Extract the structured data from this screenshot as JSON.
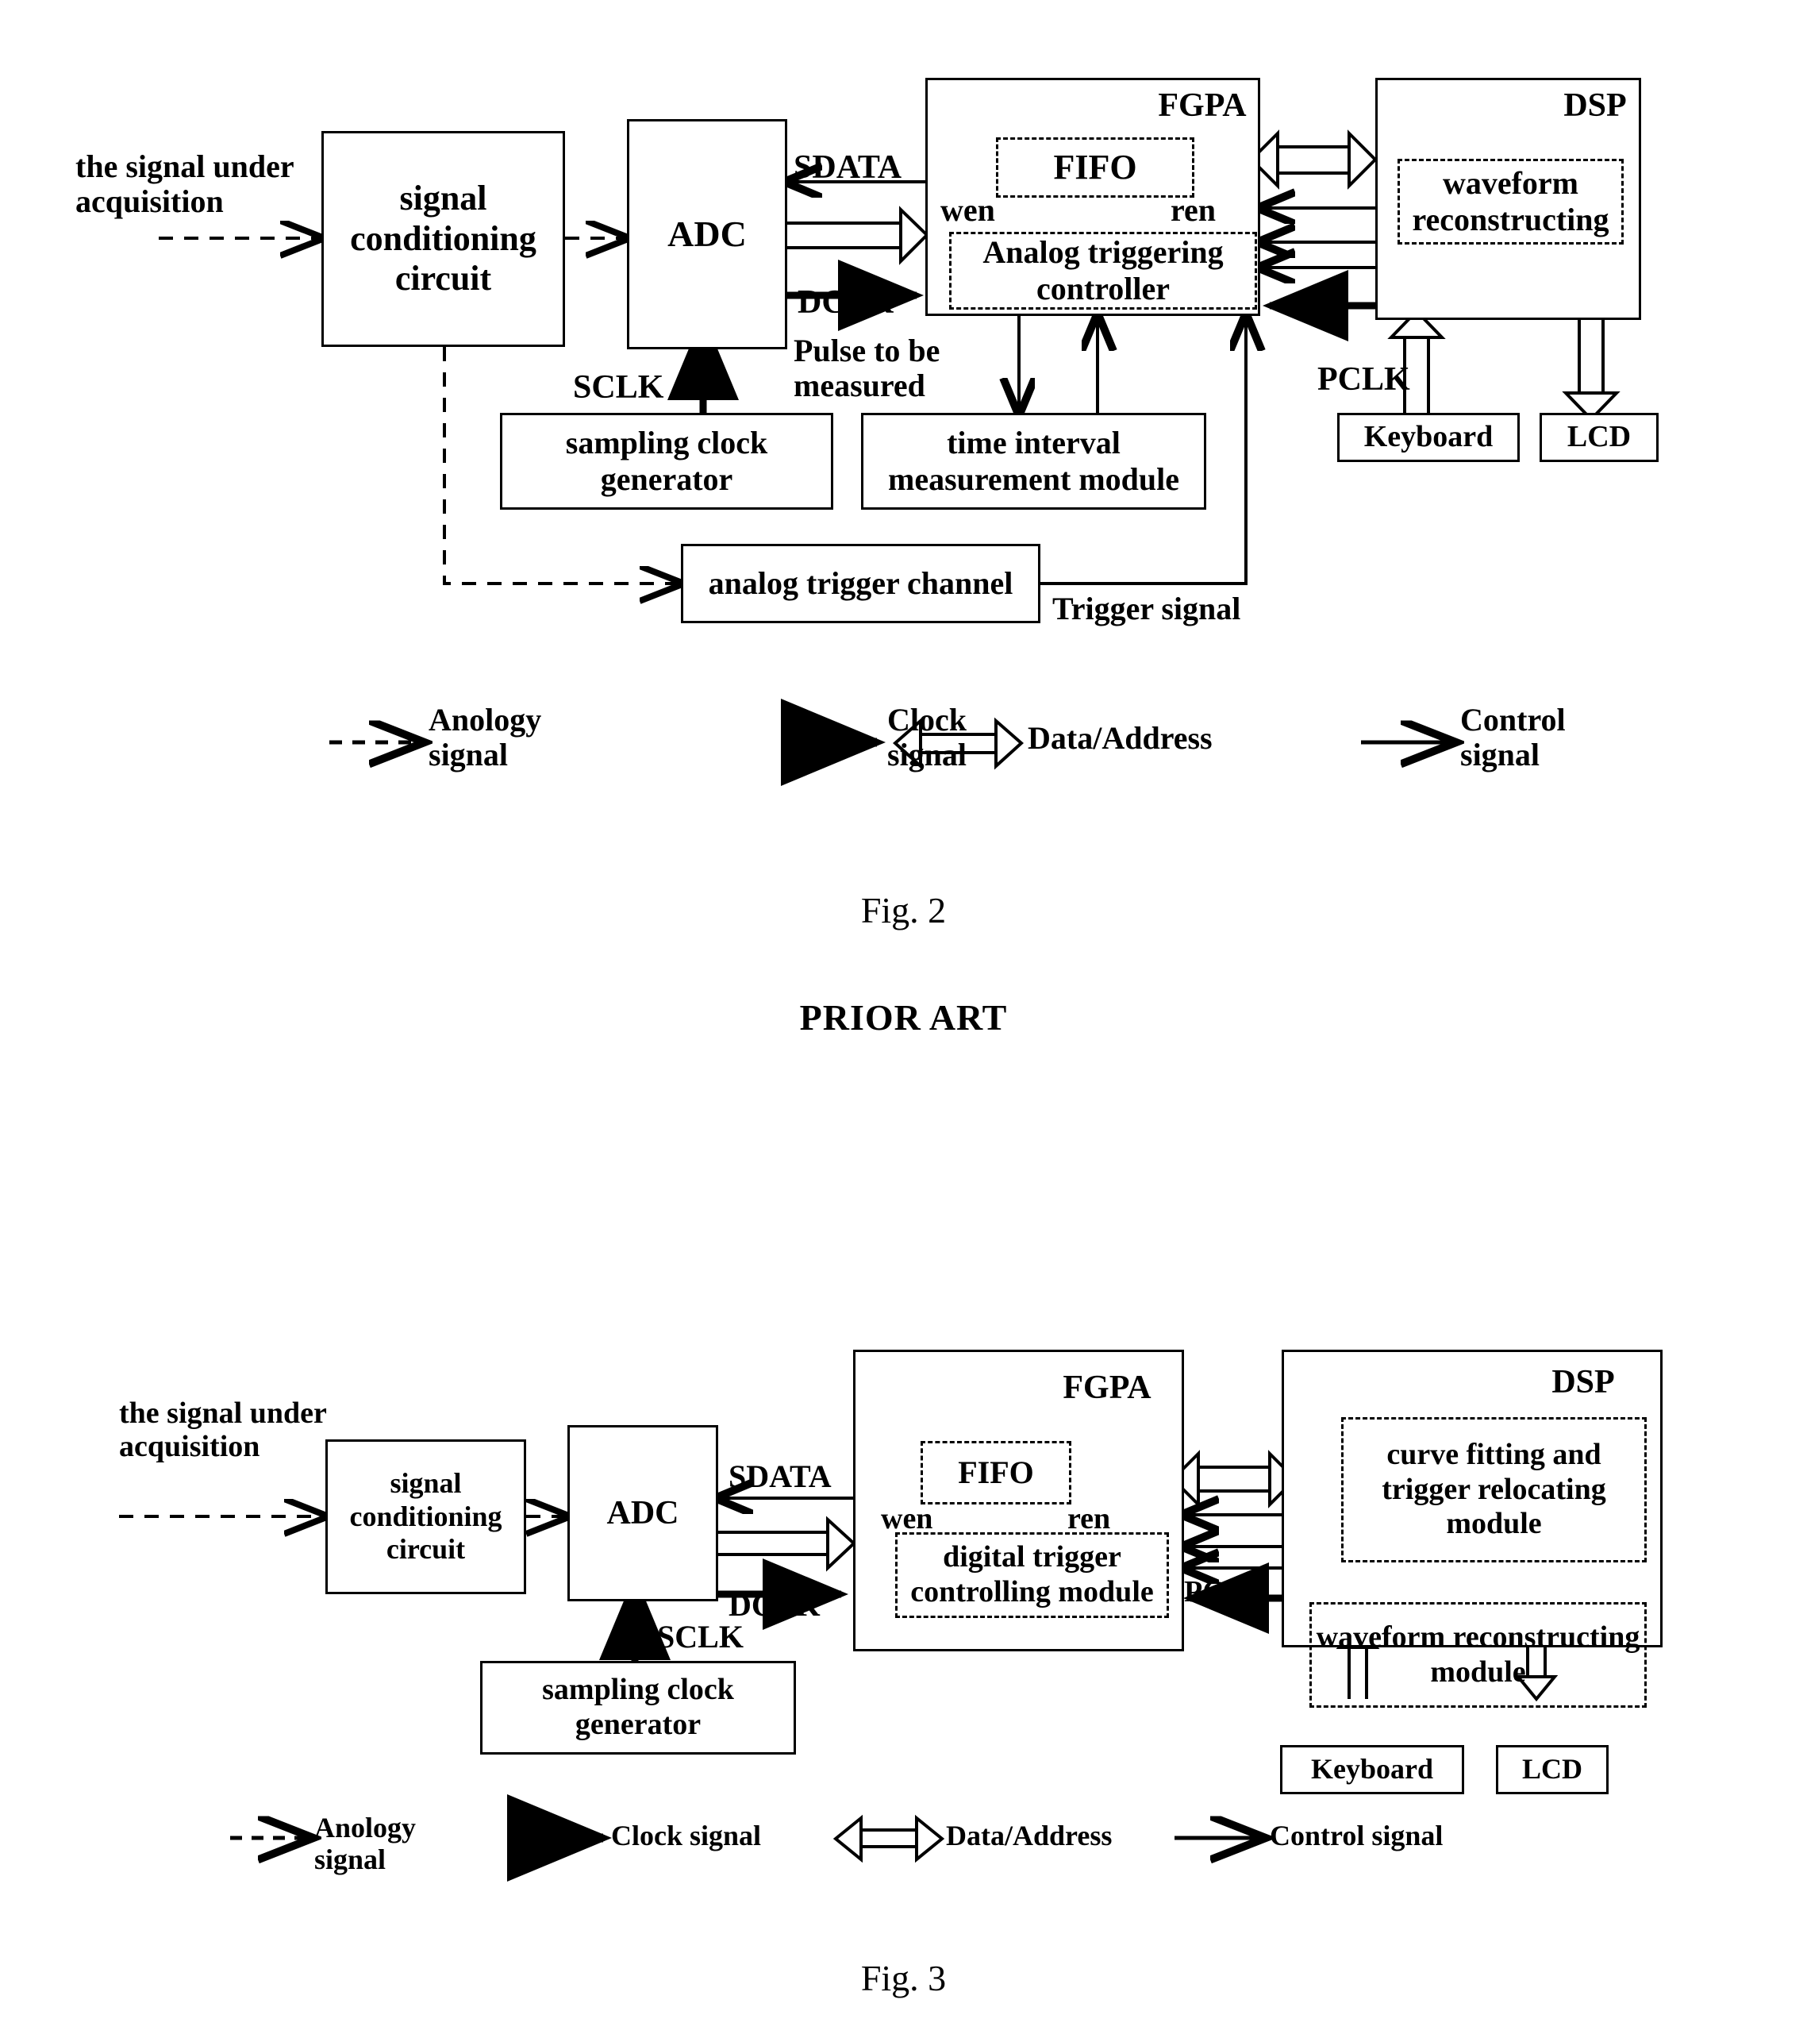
{
  "figures": [
    {
      "id": "fig2",
      "caption": "Fig. 2",
      "note": "PRIOR ART",
      "input_label": "the signal under\nacquisition",
      "blocks": {
        "signal_conditioning": "signal\nconditioning\ncircuit",
        "adc": "ADC",
        "fpga": "FGPA",
        "fifo": "FIFO",
        "trigger_controller": "Analog triggering\ncontroller",
        "dsp": "DSP",
        "waveform_reconstructing": "waveform\nreconstructing",
        "sampling_clock_generator": "sampling clock\ngenerator",
        "time_interval_module": "time interval\nmeasurement module",
        "analog_trigger_channel": "analog trigger\nchannel",
        "keyboard": "Keyboard",
        "lcd": "LCD"
      },
      "signal_labels": {
        "sdata": "SDATA",
        "dclk": "DCLK",
        "sclk": "SCLK",
        "pclk": "PCLK",
        "wen": "wen",
        "ren": "ren",
        "pulse": "Pulse to be\nmeasured",
        "trigger": "Trigger signal"
      },
      "legend": [
        {
          "icon": "dashed-arrow-icon",
          "label": "Anology\nsignal"
        },
        {
          "icon": "solid-thick-arrow-icon",
          "label": "Clock\nsignal"
        },
        {
          "icon": "double-headed-hollow-arrow-icon",
          "label": "Data/Address"
        },
        {
          "icon": "thin-arrow-icon",
          "label": "Control\nsignal"
        }
      ]
    },
    {
      "id": "fig3",
      "caption": "Fig. 3",
      "note": "",
      "input_label": "the signal under\nacquisition",
      "blocks": {
        "signal_conditioning": "signal\nconditioning\ncircuit",
        "adc": "ADC",
        "fpga": "FGPA",
        "fifo": "FIFO",
        "trigger_controller": "digital trigger\ncontrolling module",
        "dsp": "DSP",
        "curve_fitting": "curve fitting and\ntrigger relocating\nmodule",
        "waveform_reconstructing": "waveform\nreconstructing module",
        "sampling_clock_generator": "sampling clock\ngenerator",
        "keyboard": "Keyboard",
        "lcd": "LCD"
      },
      "signal_labels": {
        "sdata": "SDATA",
        "dclk": "DCLK",
        "sclk": "SCLK",
        "pclk": "PCLK",
        "wen": "wen",
        "ren": "ren"
      },
      "legend": [
        {
          "icon": "dashed-arrow-icon",
          "label": "Anology\nsignal"
        },
        {
          "icon": "solid-thick-arrow-icon",
          "label": "Clock signal"
        },
        {
          "icon": "double-headed-hollow-arrow-icon",
          "label": "Data/Address"
        },
        {
          "icon": "thin-arrow-icon",
          "label": "Control signal"
        }
      ]
    }
  ],
  "colors": {
    "ink": "#000000",
    "paper": "#ffffff"
  }
}
